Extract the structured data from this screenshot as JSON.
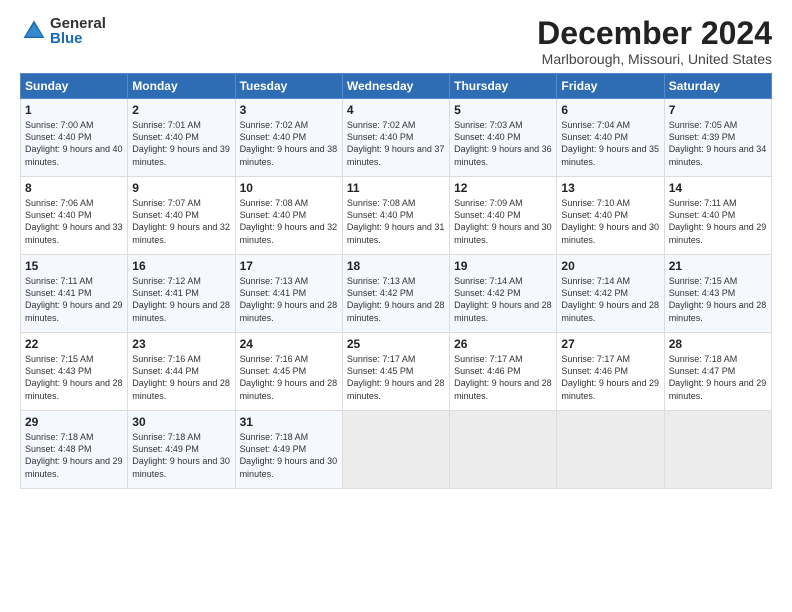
{
  "logo": {
    "general": "General",
    "blue": "Blue"
  },
  "title": "December 2024",
  "location": "Marlborough, Missouri, United States",
  "days_of_week": [
    "Sunday",
    "Monday",
    "Tuesday",
    "Wednesday",
    "Thursday",
    "Friday",
    "Saturday"
  ],
  "weeks": [
    [
      {
        "day": "1",
        "sunrise": "7:00 AM",
        "sunset": "4:40 PM",
        "daylight": "9 hours and 40 minutes."
      },
      {
        "day": "2",
        "sunrise": "7:01 AM",
        "sunset": "4:40 PM",
        "daylight": "9 hours and 39 minutes."
      },
      {
        "day": "3",
        "sunrise": "7:02 AM",
        "sunset": "4:40 PM",
        "daylight": "9 hours and 38 minutes."
      },
      {
        "day": "4",
        "sunrise": "7:02 AM",
        "sunset": "4:40 PM",
        "daylight": "9 hours and 37 minutes."
      },
      {
        "day": "5",
        "sunrise": "7:03 AM",
        "sunset": "4:40 PM",
        "daylight": "9 hours and 36 minutes."
      },
      {
        "day": "6",
        "sunrise": "7:04 AM",
        "sunset": "4:40 PM",
        "daylight": "9 hours and 35 minutes."
      },
      {
        "day": "7",
        "sunrise": "7:05 AM",
        "sunset": "4:39 PM",
        "daylight": "9 hours and 34 minutes."
      }
    ],
    [
      {
        "day": "8",
        "sunrise": "7:06 AM",
        "sunset": "4:40 PM",
        "daylight": "9 hours and 33 minutes."
      },
      {
        "day": "9",
        "sunrise": "7:07 AM",
        "sunset": "4:40 PM",
        "daylight": "9 hours and 32 minutes."
      },
      {
        "day": "10",
        "sunrise": "7:08 AM",
        "sunset": "4:40 PM",
        "daylight": "9 hours and 32 minutes."
      },
      {
        "day": "11",
        "sunrise": "7:08 AM",
        "sunset": "4:40 PM",
        "daylight": "9 hours and 31 minutes."
      },
      {
        "day": "12",
        "sunrise": "7:09 AM",
        "sunset": "4:40 PM",
        "daylight": "9 hours and 30 minutes."
      },
      {
        "day": "13",
        "sunrise": "7:10 AM",
        "sunset": "4:40 PM",
        "daylight": "9 hours and 30 minutes."
      },
      {
        "day": "14",
        "sunrise": "7:11 AM",
        "sunset": "4:40 PM",
        "daylight": "9 hours and 29 minutes."
      }
    ],
    [
      {
        "day": "15",
        "sunrise": "7:11 AM",
        "sunset": "4:41 PM",
        "daylight": "9 hours and 29 minutes."
      },
      {
        "day": "16",
        "sunrise": "7:12 AM",
        "sunset": "4:41 PM",
        "daylight": "9 hours and 28 minutes."
      },
      {
        "day": "17",
        "sunrise": "7:13 AM",
        "sunset": "4:41 PM",
        "daylight": "9 hours and 28 minutes."
      },
      {
        "day": "18",
        "sunrise": "7:13 AM",
        "sunset": "4:42 PM",
        "daylight": "9 hours and 28 minutes."
      },
      {
        "day": "19",
        "sunrise": "7:14 AM",
        "sunset": "4:42 PM",
        "daylight": "9 hours and 28 minutes."
      },
      {
        "day": "20",
        "sunrise": "7:14 AM",
        "sunset": "4:42 PM",
        "daylight": "9 hours and 28 minutes."
      },
      {
        "day": "21",
        "sunrise": "7:15 AM",
        "sunset": "4:43 PM",
        "daylight": "9 hours and 28 minutes."
      }
    ],
    [
      {
        "day": "22",
        "sunrise": "7:15 AM",
        "sunset": "4:43 PM",
        "daylight": "9 hours and 28 minutes."
      },
      {
        "day": "23",
        "sunrise": "7:16 AM",
        "sunset": "4:44 PM",
        "daylight": "9 hours and 28 minutes."
      },
      {
        "day": "24",
        "sunrise": "7:16 AM",
        "sunset": "4:45 PM",
        "daylight": "9 hours and 28 minutes."
      },
      {
        "day": "25",
        "sunrise": "7:17 AM",
        "sunset": "4:45 PM",
        "daylight": "9 hours and 28 minutes."
      },
      {
        "day": "26",
        "sunrise": "7:17 AM",
        "sunset": "4:46 PM",
        "daylight": "9 hours and 28 minutes."
      },
      {
        "day": "27",
        "sunrise": "7:17 AM",
        "sunset": "4:46 PM",
        "daylight": "9 hours and 29 minutes."
      },
      {
        "day": "28",
        "sunrise": "7:18 AM",
        "sunset": "4:47 PM",
        "daylight": "9 hours and 29 minutes."
      }
    ],
    [
      {
        "day": "29",
        "sunrise": "7:18 AM",
        "sunset": "4:48 PM",
        "daylight": "9 hours and 29 minutes."
      },
      {
        "day": "30",
        "sunrise": "7:18 AM",
        "sunset": "4:49 PM",
        "daylight": "9 hours and 30 minutes."
      },
      {
        "day": "31",
        "sunrise": "7:18 AM",
        "sunset": "4:49 PM",
        "daylight": "9 hours and 30 minutes."
      },
      null,
      null,
      null,
      null
    ]
  ],
  "labels": {
    "sunrise": "Sunrise:",
    "sunset": "Sunset:",
    "daylight": "Daylight:"
  }
}
